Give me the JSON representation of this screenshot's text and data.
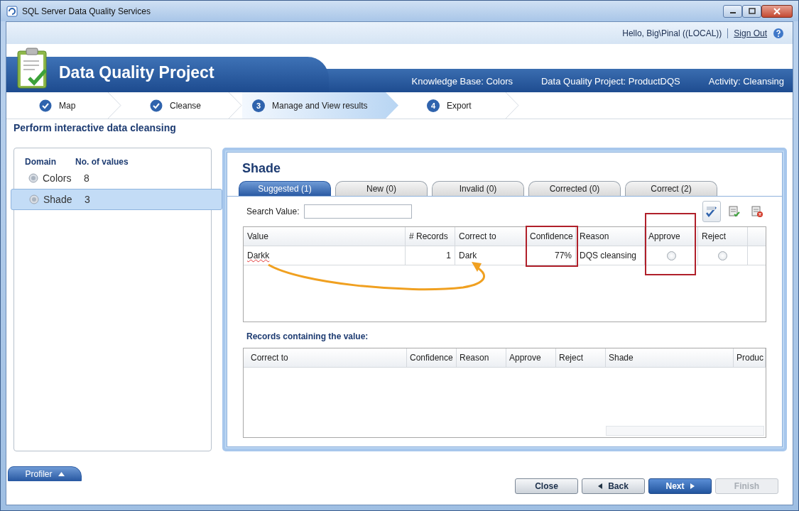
{
  "window": {
    "title": "SQL Server Data Quality Services"
  },
  "header": {
    "greeting": "Hello, Big\\Pinal ((LOCAL))",
    "sign_out": "Sign Out"
  },
  "banner": {
    "title": "Data Quality Project",
    "info": [
      "Knowledge Base: Colors",
      "Data Quality Project: ProductDQS",
      "Activity: Cleansing"
    ]
  },
  "steps": [
    {
      "label": "Map",
      "done": true,
      "selected": false
    },
    {
      "label": "Cleanse",
      "done": true,
      "selected": false
    },
    {
      "number": "3",
      "label": "Manage and View results",
      "done": false,
      "selected": true
    },
    {
      "number": "4",
      "label": "Export",
      "done": false,
      "selected": false
    }
  ],
  "page_title": "Perform interactive data cleansing",
  "domains": {
    "headings": [
      "Domain",
      "No. of values"
    ],
    "items": [
      {
        "name": "Colors",
        "count": "8",
        "selected": false
      },
      {
        "name": "Shade",
        "count": "3",
        "selected": true
      }
    ]
  },
  "detail": {
    "title": "Shade",
    "tabs": [
      {
        "label": "Suggested (1)",
        "selected": true
      },
      {
        "label": "New (0)",
        "selected": false
      },
      {
        "label": "Invalid (0)",
        "selected": false
      },
      {
        "label": "Corrected (0)",
        "selected": false
      },
      {
        "label": "Correct (2)",
        "selected": false
      }
    ],
    "search": {
      "label": "Search Value:"
    },
    "table": {
      "columns": [
        "Value",
        "# Records",
        "Correct to",
        "Confidence",
        "Reason",
        "Approve",
        "Reject"
      ],
      "rows": [
        {
          "value": "Darkk",
          "records": "1",
          "correct_to": "Dark",
          "confidence": "77%",
          "reason": "DQS cleansing",
          "approve": false,
          "reject": false
        }
      ]
    },
    "records_title": "Records containing the value:",
    "records_table": {
      "columns": [
        "Correct to",
        "Confidence",
        "Reason",
        "Approve",
        "Reject",
        "Shade",
        "Produc"
      ]
    }
  },
  "profiler": {
    "label": "Profiler"
  },
  "buttons": [
    {
      "label": "Close",
      "kind": "plain",
      "disabled": false
    },
    {
      "label": "Back",
      "kind": "back",
      "disabled": false
    },
    {
      "label": "Next",
      "kind": "next",
      "disabled": false
    },
    {
      "label": "Finish",
      "kind": "plain",
      "disabled": true
    }
  ]
}
